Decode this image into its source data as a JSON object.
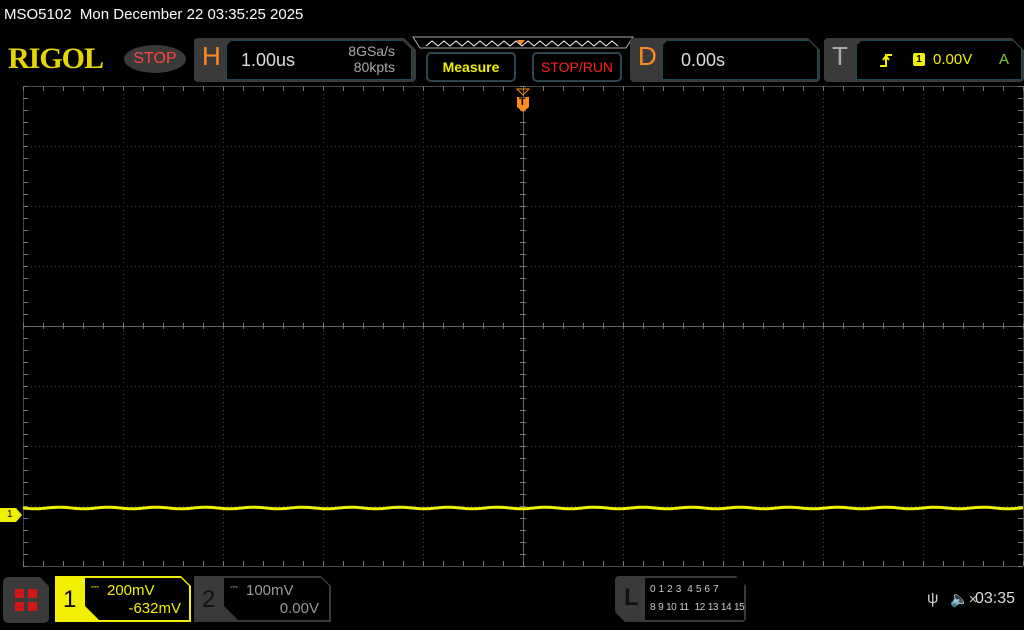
{
  "titlebar": {
    "model": "MSO5102",
    "datetime": "Mon December 22 03:35:25 2025"
  },
  "logo": "RIGOL",
  "run_status": "STOP",
  "horizontal": {
    "letter": "H",
    "timebase": "1.00us",
    "sample_rate": "8GSa/s",
    "memory_depth": "80kpts"
  },
  "buttons": {
    "measure": "Measure",
    "stop_run": "STOP/RUN"
  },
  "delay": {
    "letter": "D",
    "value": "0.00s"
  },
  "trigger": {
    "letter": "T",
    "source": "1",
    "level": "0.00V",
    "mode": "A",
    "slope_icon": "rising-edge-icon",
    "marker": "T"
  },
  "channels": [
    {
      "number": "1",
      "scale": "200mV",
      "offset": "-632mV",
      "color": "#f0f000",
      "active": true
    },
    {
      "number": "2",
      "scale": "100mV",
      "offset": "0.00V",
      "color": "#9a9a9a",
      "active": false
    }
  ],
  "channel1_marker": "1",
  "logic": {
    "letter": "L",
    "row1": [
      "0",
      "1",
      "2",
      "3",
      "4",
      "5",
      "6",
      "7"
    ],
    "row2": [
      "8",
      "9",
      "10",
      "11",
      "12",
      "13",
      "14",
      "15"
    ]
  },
  "status": {
    "clock": "03:35",
    "usb_icon": "usb-icon",
    "sound_icon": "speaker-muted-icon"
  },
  "colors": {
    "trace": "#f0f000",
    "accent": "#ff8c1a",
    "stop": "#ff4444"
  }
}
